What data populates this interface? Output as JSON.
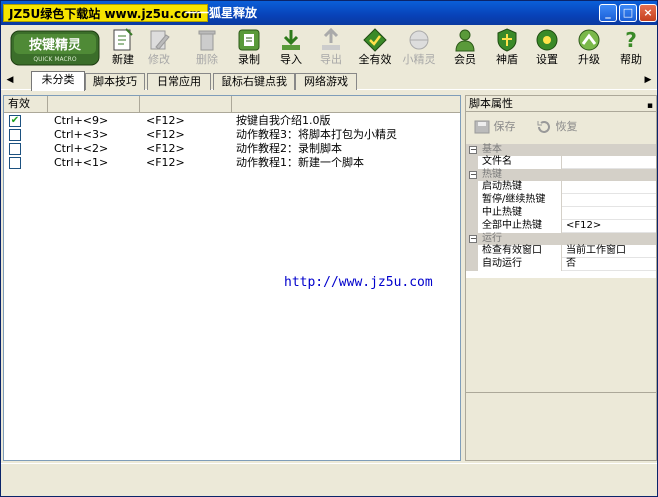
{
  "window": {
    "watermark": "JZ5U绿色下载站 www.jz5u.com",
    "title": "一一狐星释放"
  },
  "toolbar": {
    "logo_text": "按键精灵",
    "logo_sub": "QUICK MACRO",
    "items": [
      {
        "label": "新建",
        "icon": "new-script-icon",
        "enabled": true
      },
      {
        "label": "修改",
        "icon": "edit-icon",
        "enabled": false
      },
      {
        "label": "删除",
        "icon": "delete-icon",
        "enabled": false
      },
      {
        "label": "录制",
        "icon": "record-icon",
        "enabled": true
      },
      {
        "label": "导入",
        "icon": "import-icon",
        "enabled": true
      },
      {
        "label": "导出",
        "icon": "export-icon",
        "enabled": false
      },
      {
        "label": "全有效",
        "icon": "enable-all-icon",
        "enabled": true
      },
      {
        "label": "小精灵",
        "icon": "sprite-icon",
        "enabled": false
      },
      {
        "label": "会员",
        "icon": "member-icon",
        "enabled": true
      },
      {
        "label": "神盾",
        "icon": "shield-icon",
        "enabled": true
      },
      {
        "label": "设置",
        "icon": "settings-icon",
        "enabled": true
      },
      {
        "label": "升级",
        "icon": "upgrade-icon",
        "enabled": true
      },
      {
        "label": "帮助",
        "icon": "help-icon",
        "enabled": true
      }
    ]
  },
  "tabs": [
    "未分类",
    "脚本技巧",
    "日常应用",
    "鼠标右键点我",
    "网络游戏"
  ],
  "list": {
    "header": "有效",
    "rows": [
      {
        "checked": true,
        "hotkey": "Ctrl+<9>",
        "stop": "<F12>",
        "name": "按键自我介绍1.0版"
      },
      {
        "checked": false,
        "hotkey": "Ctrl+<3>",
        "stop": "<F12>",
        "name": "动作教程3：将脚本打包为小精灵"
      },
      {
        "checked": false,
        "hotkey": "Ctrl+<2>",
        "stop": "<F12>",
        "name": "动作教程2：录制脚本"
      },
      {
        "checked": false,
        "hotkey": "Ctrl+<1>",
        "stop": "<F12>",
        "name": "动作教程1：新建一个脚本"
      }
    ],
    "url": "http://www.jz5u.com"
  },
  "props": {
    "title": "脚本属性",
    "save": "保存",
    "restore": "恢复",
    "cat_basic": "基本",
    "filename": "文件名",
    "cat_hotkey": "热键",
    "start_hotkey": "启动热键",
    "pause_hotkey": "暂停/继续热键",
    "stop_hotkey": "中止热键",
    "stopall_hotkey": "全部中止热键",
    "stopall_value": "<F12>",
    "cat_run": "运行",
    "check_window": "检查有效窗口",
    "check_window_value": "当前工作窗口",
    "autorun": "自动运行",
    "autorun_value": "否"
  }
}
